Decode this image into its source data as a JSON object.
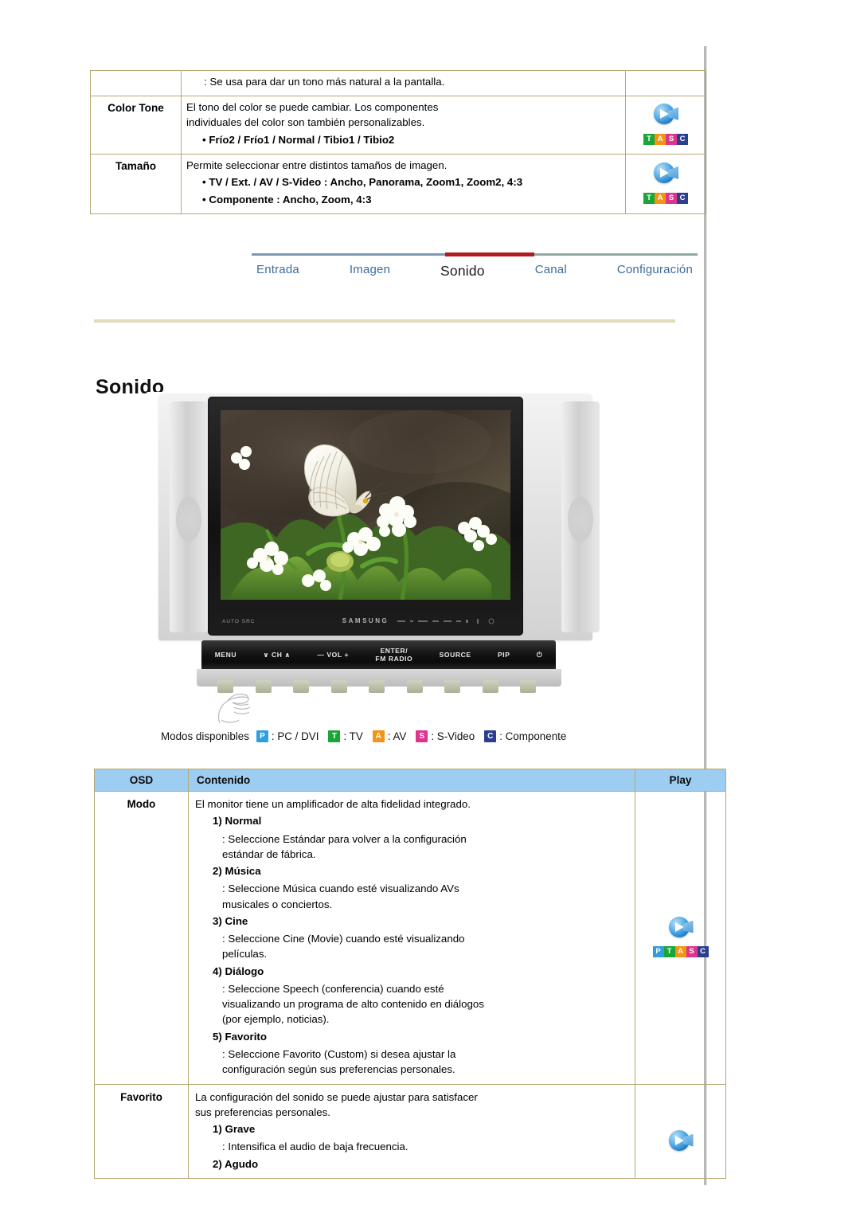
{
  "top_table": {
    "rows": [
      {
        "label": "",
        "lines": [
          {
            "text": ": Se usa para dar un tono más natural a la pantalla.",
            "style": "indent"
          }
        ],
        "play": null
      },
      {
        "label": "Color Tone",
        "lines": [
          {
            "text": "El tono del color se puede cambiar. Los componentes",
            "style": "plain"
          },
          {
            "text": "individuales del color son también personalizables.",
            "style": "plain"
          },
          {
            "text": "• Frío2 / Frío1 / Normal / Tibio1 / Tibio2",
            "style": "bullet"
          }
        ],
        "play": {
          "icon": "speaker-play-icon",
          "tags": [
            "T",
            "A",
            "S",
            "C"
          ]
        }
      },
      {
        "label": "Tamaño",
        "lines": [
          {
            "text": "Permite seleccionar entre distintos tamaños de imagen.",
            "style": "plain"
          },
          {
            "text": "• TV / Ext. / AV / S-Video : Ancho, Panorama, Zoom1, Zoom2, 4:3",
            "style": "bullet"
          },
          {
            "text": "• Componente : Ancho, Zoom, 4:3",
            "style": "bullet"
          }
        ],
        "play": {
          "icon": "speaker-play-icon",
          "tags": [
            "T",
            "A",
            "S",
            "C"
          ]
        }
      }
    ]
  },
  "nav": {
    "items": [
      {
        "label": "Entrada",
        "active": false
      },
      {
        "label": "Imagen",
        "active": false
      },
      {
        "label": "Sonido",
        "active": true
      },
      {
        "label": "Canal",
        "active": false
      },
      {
        "label": "Configuración",
        "active": false
      }
    ],
    "active_color": "#b01c21",
    "rule_color": "#7d99b5",
    "link_color": "#3c6b9e"
  },
  "section": {
    "title": "Sonido",
    "rule_color": "#dedcbb"
  },
  "monitor": {
    "brand": "SAMSUNG",
    "side_mark": "AUTO   SRC",
    "controls": [
      "MENU",
      "∨  CH  ∧",
      "—  VOL  +",
      "ENTER/\nFM RADIO",
      "SOURCE",
      "PIP",
      "⏻"
    ]
  },
  "legend": {
    "label": "Modos disponibles",
    "modes": [
      {
        "tag": "P",
        "tag_class": "p",
        "text": ": PC / DVI"
      },
      {
        "tag": "T",
        "tag_class": "t",
        "text": ": TV"
      },
      {
        "tag": "A",
        "tag_class": "a",
        "text": ": AV"
      },
      {
        "tag": "S",
        "tag_class": "s",
        "text": ": S-Video"
      },
      {
        "tag": "C",
        "tag_class": "c",
        "text": ": Componente"
      }
    ]
  },
  "osd_table": {
    "headers": {
      "osd": "OSD",
      "content": "Contenido",
      "play": "Play"
    },
    "header_bg": "#9ecdf2",
    "border_color": "#b5a871",
    "rows": [
      {
        "osd": "Modo",
        "lines": [
          {
            "text": "El monitor tiene un amplificador de alta fidelidad integrado.",
            "style": "plain"
          },
          {
            "text": "1) Normal",
            "style": "sub-h"
          },
          {
            "text": ": Seleccione Estándar para volver a la configuración",
            "style": "sub-b"
          },
          {
            "text": "estándar de fábrica.",
            "style": "sub-b2"
          },
          {
            "text": "2) Música",
            "style": "sub-h"
          },
          {
            "text": ": Seleccione Música cuando esté visualizando AVs",
            "style": "sub-b"
          },
          {
            "text": "musicales o conciertos.",
            "style": "sub-b2"
          },
          {
            "text": "3) Cine",
            "style": "sub-h"
          },
          {
            "text": ": Seleccione Cine (Movie) cuando esté visualizando",
            "style": "sub-b"
          },
          {
            "text": "películas.",
            "style": "sub-b2"
          },
          {
            "text": "4) Diálogo",
            "style": "sub-h"
          },
          {
            "text": ": Seleccione Speech (conferencia) cuando esté",
            "style": "sub-b"
          },
          {
            "text": "visualizando un programa de alto contenido en diálogos",
            "style": "sub-b2"
          },
          {
            "text": "(por ejemplo, noticias).",
            "style": "sub-b2"
          },
          {
            "text": "5) Favorito",
            "style": "sub-h"
          },
          {
            "text": ": Seleccione Favorito (Custom) si desea ajustar la",
            "style": "sub-b"
          },
          {
            "text": "configuración según sus preferencias personales.",
            "style": "sub-b2"
          }
        ],
        "play": {
          "icon": "speaker-play-icon",
          "tags": [
            "P",
            "T",
            "A",
            "S",
            "C"
          ]
        }
      },
      {
        "osd": "Favorito",
        "lines": [
          {
            "text": "La configuración del sonido se puede ajustar para satisfacer",
            "style": "plain"
          },
          {
            "text": "sus preferencias personales.",
            "style": "plain"
          },
          {
            "text": "1) Grave",
            "style": "sub-h"
          },
          {
            "text": ": Intensifica el audio de baja frecuencia.",
            "style": "sub-b"
          },
          {
            "text": "2) Agudo",
            "style": "sub-h"
          }
        ],
        "play": {
          "icon": "speaker-play-icon",
          "tags": []
        }
      }
    ]
  }
}
